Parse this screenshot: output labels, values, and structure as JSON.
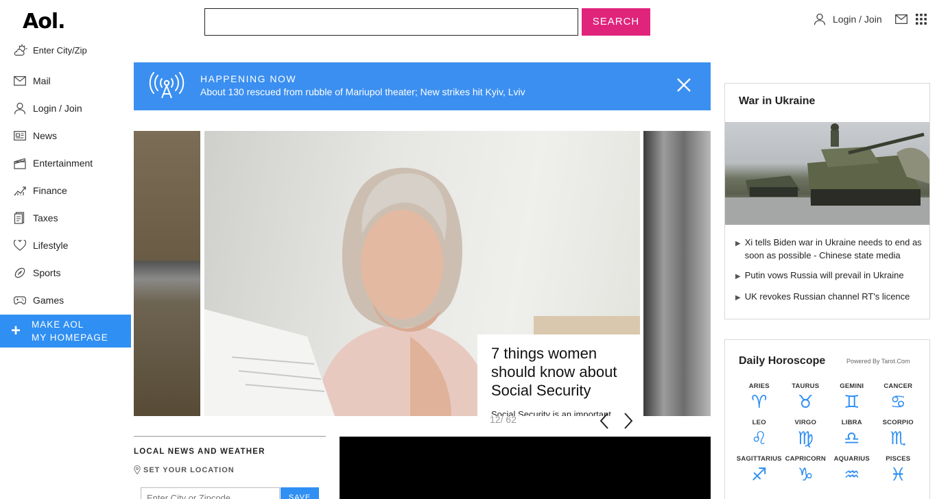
{
  "header": {
    "logo": "Aol.",
    "search_placeholder": "",
    "search_button": "SEARCH",
    "login_label": "Login / Join"
  },
  "sidebar": {
    "weather_label": "Enter City/Zip",
    "items": [
      {
        "label": "Mail",
        "icon": "mail-icon"
      },
      {
        "label": "Login / Join",
        "icon": "user-icon"
      },
      {
        "label": "News",
        "icon": "newspaper-icon"
      },
      {
        "label": "Entertainment",
        "icon": "clapperboard-icon"
      },
      {
        "label": "Finance",
        "icon": "chart-icon"
      },
      {
        "label": "Taxes",
        "icon": "document-icon"
      },
      {
        "label": "Lifestyle",
        "icon": "heart-icon"
      },
      {
        "label": "Sports",
        "icon": "football-icon"
      },
      {
        "label": "Games",
        "icon": "gamepad-icon"
      }
    ],
    "make_home_line1": "MAKE AOL",
    "make_home_line2": "MY HOMEPAGE"
  },
  "happening": {
    "tag": "HAPPENING NOW",
    "headline": "About 130 rescued from rubble of Mariupol theater; New strikes hit Kyiv, Lviv"
  },
  "carousel": {
    "title": "7 things women should know about Social Security",
    "description": "Social Security is an important source of retirement income,",
    "counter": "12/ 62"
  },
  "local": {
    "heading": "LOCAL NEWS AND WEATHER",
    "set_location": "SET YOUR LOCATION",
    "zip_placeholder": "Enter City or Zipcode",
    "save_label": "SAVE"
  },
  "ukraine": {
    "title": "War in Ukraine",
    "items": [
      "Xi tells Biden war in Ukraine needs to end as soon as possible - Chinese state media",
      "Putin vows Russia will prevail in Ukraine",
      "UK revokes Russian channel RT's licence"
    ]
  },
  "horoscope": {
    "title": "Daily Horoscope",
    "powered_by": "Powered By Tarot.Com",
    "signs": [
      {
        "name": "ARIES",
        "glyph": "♈︎"
      },
      {
        "name": "TAURUS",
        "glyph": "♉︎"
      },
      {
        "name": "GEMINI",
        "glyph": "♊︎"
      },
      {
        "name": "CANCER",
        "glyph": "♋︎"
      },
      {
        "name": "LEO",
        "glyph": "♌︎"
      },
      {
        "name": "VIRGO",
        "glyph": "♍︎"
      },
      {
        "name": "LIBRA",
        "glyph": "♎︎"
      },
      {
        "name": "SCORPIO",
        "glyph": "♏︎"
      },
      {
        "name": "SAGITTARIUS",
        "glyph": "♐︎"
      },
      {
        "name": "CAPRICORN",
        "glyph": "♑︎"
      },
      {
        "name": "AQUARIUS",
        "glyph": "♒︎"
      },
      {
        "name": "PISCES",
        "glyph": "♓︎"
      }
    ]
  },
  "colors": {
    "accent": "#2f8ff3",
    "search": "#e0247c"
  }
}
